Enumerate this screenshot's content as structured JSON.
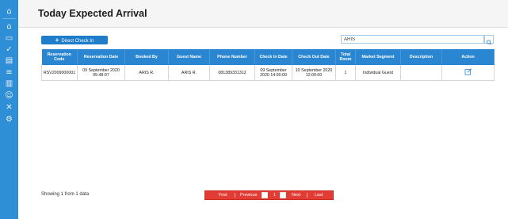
{
  "sidebar": {
    "icons": [
      {
        "name": "building-icon",
        "glyph": "⌂"
      },
      {
        "name": "home-icon",
        "glyph": "⌂"
      },
      {
        "name": "monitor-icon",
        "glyph": "▭"
      },
      {
        "name": "check-icon",
        "glyph": "✓"
      },
      {
        "name": "clipboard-icon",
        "glyph": "▤"
      },
      {
        "name": "sliders-icon",
        "glyph": "≡"
      },
      {
        "name": "chart-icon",
        "glyph": "▥"
      },
      {
        "name": "person-icon",
        "glyph": "☺"
      },
      {
        "name": "tools-icon",
        "glyph": "✕"
      },
      {
        "name": "settings-icon",
        "glyph": "⚙"
      }
    ]
  },
  "header": {
    "title": "Today Expected Arrival"
  },
  "toolbar": {
    "direct_checkin_label": "Direct Check In",
    "search_value": "ARIS",
    "search_icon": "search-icon"
  },
  "table": {
    "columns": [
      "Reservation Code",
      "Reservation Date",
      "Booked By",
      "Guest Name",
      "Phone Number",
      "Check In Date",
      "Check Out Date",
      "Total Room",
      "Market Segment",
      "Description",
      "Action"
    ],
    "rows": [
      {
        "reservation_code": "RSV2009000001",
        "reservation_date": "09 September 2020 05:48:07",
        "booked_by": "ARIS R.",
        "guest_name": "ARIS R.",
        "phone_number": "081389331312",
        "check_in_date": "09 September 2020 14:00:00",
        "check_out_date": "10 September 2020 12:00:00",
        "total_room": "1",
        "market_segment": "Individual Guest",
        "description": "",
        "action_icon": "edit-icon"
      }
    ]
  },
  "footer": {
    "showing_text": "Showing 1 from 1 data",
    "pager": {
      "first": "First",
      "previous": "Previous",
      "page": "1",
      "next": "Next",
      "last": "Last"
    }
  },
  "colors": {
    "sidebar": "#2f8fd6",
    "table_header": "#2a86d1",
    "button": "#1f7dc9",
    "pager": "#e23c34"
  }
}
